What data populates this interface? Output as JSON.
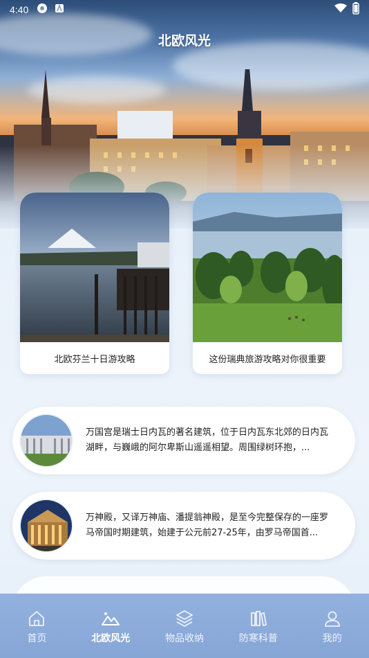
{
  "status_bar": {
    "time": "4:40"
  },
  "header": {
    "title": "北欧风光"
  },
  "featured": [
    {
      "caption": "北欧芬兰十日游攻略"
    },
    {
      "caption": "这份瑞典旅游攻略对你很重要"
    }
  ],
  "articles": [
    {
      "summary": "万国宫是瑞士日内瓦的著名建筑，位于日内瓦东北郊的日内瓦湖畔，与巍峨的阿尔卑斯山遥遥相望。周围绿树环抱，..."
    },
    {
      "summary": "万神殿，又译万神庙、潘提翁神殿，是至今完整保存的一座罗马帝国时期建筑，始建于公元前27-25年，由罗马帝国首..."
    }
  ],
  "nav": {
    "items": [
      {
        "label": "首页",
        "icon": "home-icon"
      },
      {
        "label": "北欧风光",
        "icon": "landscape-icon"
      },
      {
        "label": "物品收纳",
        "icon": "layers-icon"
      },
      {
        "label": "防寒科普",
        "icon": "books-icon"
      },
      {
        "label": "我的",
        "icon": "user-icon"
      }
    ],
    "active": "北欧风光"
  },
  "colors": {
    "nav_bg": "#8faedd",
    "card_bg": "#ffffff"
  }
}
